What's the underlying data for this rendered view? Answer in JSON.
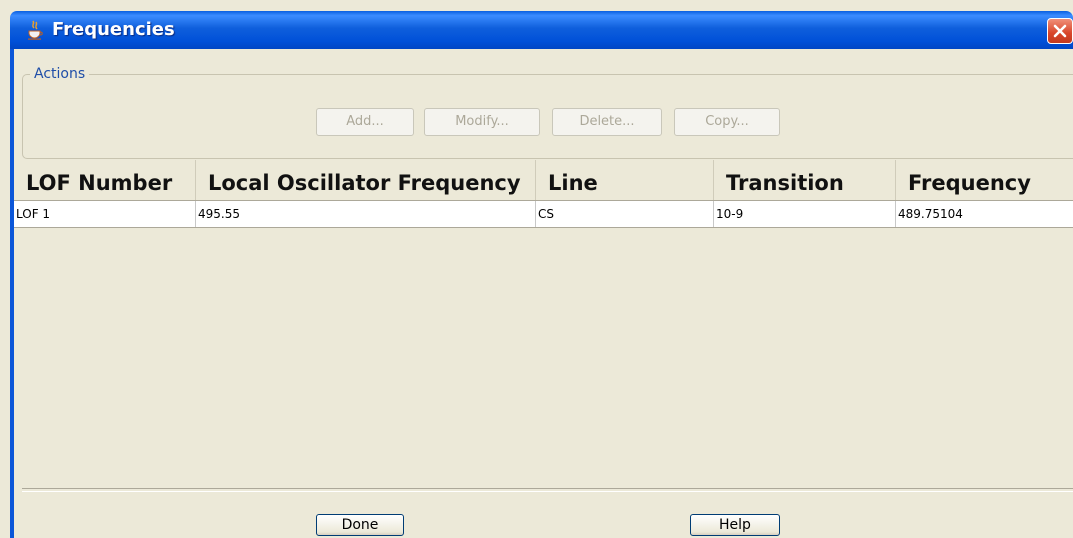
{
  "window": {
    "title": "Frequencies",
    "title_icon": "java-cup-icon",
    "close_icon": "close-icon"
  },
  "actions": {
    "legend": "Actions",
    "buttons": [
      "Add...",
      "Modify...",
      "Delete...",
      "Copy..."
    ]
  },
  "table": {
    "columns": [
      "LOF Number",
      "Local Oscillator Frequency",
      "Line",
      "Transition",
      "Frequency"
    ],
    "rows": [
      [
        "LOF 1",
        "495.55",
        "CS",
        "10-9",
        "489.75104"
      ]
    ]
  },
  "footer": {
    "done_label": "Done",
    "help_label": "Help"
  },
  "colors": {
    "titlebar": "#0050d8",
    "background": "#ece9d8",
    "close": "#d8452a"
  }
}
